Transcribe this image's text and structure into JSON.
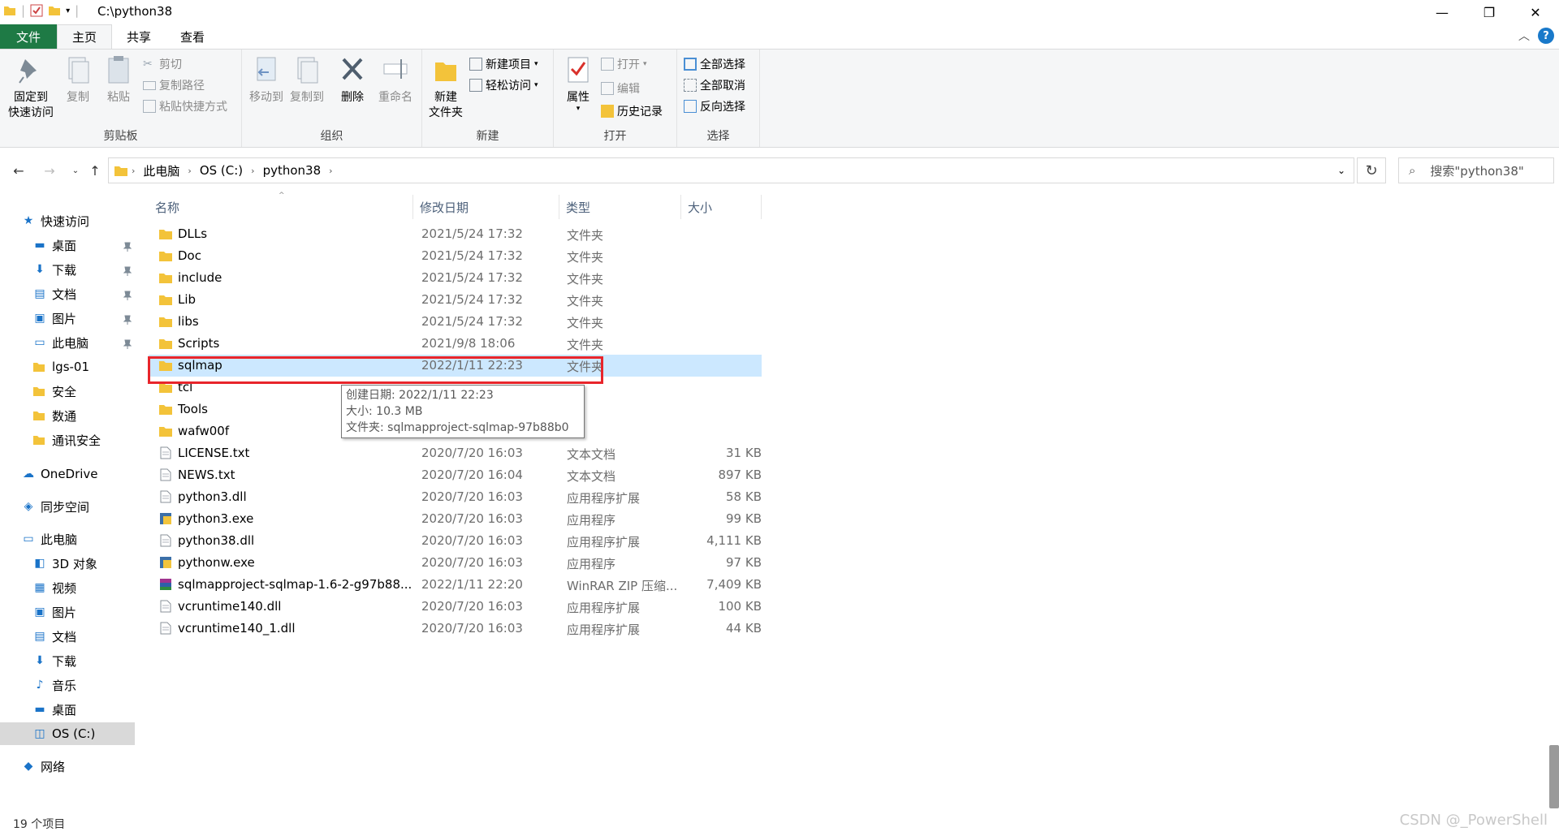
{
  "window": {
    "title": "C:\\python38",
    "minimize": "—",
    "maximize": "❐",
    "close": "✕"
  },
  "ribbon_tabs": [
    "文件",
    "主页",
    "共享",
    "查看"
  ],
  "ribbon": {
    "clipboard": {
      "label": "剪贴板",
      "pin_quick_access": "固定到\n快速访问",
      "copy": "复制",
      "paste": "粘贴",
      "cut": "剪切",
      "copy_path": "复制路径",
      "paste_shortcut": "粘贴快捷方式"
    },
    "organize": {
      "label": "组织",
      "move_to": "移动到",
      "copy_to": "复制到",
      "delete": "删除",
      "rename": "重命名"
    },
    "new": {
      "label": "新建",
      "new_folder": "新建\n文件夹",
      "new_item": "新建项目",
      "easy_access": "轻松访问"
    },
    "open": {
      "label": "打开",
      "properties": "属性",
      "open": "打开",
      "edit": "编辑",
      "history": "历史记录"
    },
    "select": {
      "label": "选择",
      "select_all": "全部选择",
      "select_none": "全部取消",
      "invert": "反向选择"
    }
  },
  "breadcrumb": [
    "此电脑",
    "OS (C:)",
    "python38"
  ],
  "search": {
    "placeholder": "搜索\"python38\""
  },
  "sidebar": {
    "items": [
      {
        "label": "快速访问",
        "icon": "star-icon",
        "pinned": false
      },
      {
        "label": "桌面",
        "icon": "desktop-icon",
        "pinned": true
      },
      {
        "label": "下载",
        "icon": "download-icon",
        "pinned": true
      },
      {
        "label": "文档",
        "icon": "document-icon",
        "pinned": true
      },
      {
        "label": "图片",
        "icon": "pictures-icon",
        "pinned": true
      },
      {
        "label": "此电脑",
        "icon": "computer-icon",
        "pinned": true
      },
      {
        "label": "lgs-01",
        "icon": "folder-icon",
        "pinned": false
      },
      {
        "label": "安全",
        "icon": "folder-icon",
        "pinned": false
      },
      {
        "label": "数通",
        "icon": "folder-icon",
        "pinned": false
      },
      {
        "label": "通讯安全",
        "icon": "folder-icon",
        "pinned": false
      },
      {
        "label": "OneDrive",
        "icon": "cloud-icon",
        "pinned": false
      },
      {
        "label": "同步空间",
        "icon": "sync-icon",
        "pinned": false
      },
      {
        "label": "此电脑",
        "icon": "computer-icon",
        "pinned": false
      },
      {
        "label": "3D 对象",
        "icon": "3d-icon",
        "pinned": false
      },
      {
        "label": "视频",
        "icon": "video-icon",
        "pinned": false
      },
      {
        "label": "图片",
        "icon": "pictures-icon",
        "pinned": false
      },
      {
        "label": "文档",
        "icon": "document-icon",
        "pinned": false
      },
      {
        "label": "下载",
        "icon": "download-icon",
        "pinned": false
      },
      {
        "label": "音乐",
        "icon": "music-icon",
        "pinned": false
      },
      {
        "label": "桌面",
        "icon": "desktop-icon",
        "pinned": false
      },
      {
        "label": "OS (C:)",
        "icon": "drive-icon",
        "pinned": false
      },
      {
        "label": "网络",
        "icon": "network-icon",
        "pinned": false
      }
    ]
  },
  "columns": [
    "名称",
    "修改日期",
    "类型",
    "大小"
  ],
  "files": [
    {
      "name": "DLLs",
      "date": "2021/5/24 17:32",
      "type": "文件夹",
      "size": "",
      "icon": "folder-icon"
    },
    {
      "name": "Doc",
      "date": "2021/5/24 17:32",
      "type": "文件夹",
      "size": "",
      "icon": "folder-icon"
    },
    {
      "name": "include",
      "date": "2021/5/24 17:32",
      "type": "文件夹",
      "size": "",
      "icon": "folder-icon"
    },
    {
      "name": "Lib",
      "date": "2021/5/24 17:32",
      "type": "文件夹",
      "size": "",
      "icon": "folder-icon"
    },
    {
      "name": "libs",
      "date": "2021/5/24 17:32",
      "type": "文件夹",
      "size": "",
      "icon": "folder-icon"
    },
    {
      "name": "Scripts",
      "date": "2021/9/8 18:06",
      "type": "文件夹",
      "size": "",
      "icon": "folder-icon"
    },
    {
      "name": "sqlmap",
      "date": "2022/1/11 22:23",
      "type": "文件夹",
      "size": "",
      "icon": "folder-icon",
      "selected": true
    },
    {
      "name": "tcl",
      "date": "",
      "type": "",
      "size": "",
      "icon": "folder-icon"
    },
    {
      "name": "Tools",
      "date": "",
      "type": "",
      "size": "",
      "icon": "folder-icon"
    },
    {
      "name": "wafw00f",
      "date": "",
      "type": "",
      "size": "",
      "icon": "folder-icon"
    },
    {
      "name": "LICENSE.txt",
      "date": "2020/7/20 16:03",
      "type": "文本文档",
      "size": "31 KB",
      "icon": "text-file-icon"
    },
    {
      "name": "NEWS.txt",
      "date": "2020/7/20 16:04",
      "type": "文本文档",
      "size": "897 KB",
      "icon": "text-file-icon"
    },
    {
      "name": "python3.dll",
      "date": "2020/7/20 16:03",
      "type": "应用程序扩展",
      "size": "58 KB",
      "icon": "dll-file-icon"
    },
    {
      "name": "python3.exe",
      "date": "2020/7/20 16:03",
      "type": "应用程序",
      "size": "99 KB",
      "icon": "python-exe-icon"
    },
    {
      "name": "python38.dll",
      "date": "2020/7/20 16:03",
      "type": "应用程序扩展",
      "size": "4,111 KB",
      "icon": "dll-file-icon"
    },
    {
      "name": "pythonw.exe",
      "date": "2020/7/20 16:03",
      "type": "应用程序",
      "size": "97 KB",
      "icon": "python-exe-icon"
    },
    {
      "name": "sqlmapproject-sqlmap-1.6-2-g97b88...",
      "date": "2022/1/11 22:20",
      "type": "WinRAR ZIP 压缩...",
      "size": "7,409 KB",
      "icon": "winrar-icon"
    },
    {
      "name": "vcruntime140.dll",
      "date": "2020/7/20 16:03",
      "type": "应用程序扩展",
      "size": "100 KB",
      "icon": "dll-file-icon"
    },
    {
      "name": "vcruntime140_1.dll",
      "date": "2020/7/20 16:03",
      "type": "应用程序扩展",
      "size": "44 KB",
      "icon": "dll-file-icon"
    }
  ],
  "tooltip": {
    "created": "创建日期: 2022/1/11 22:23",
    "size": "大小: 10.3 MB",
    "folder": "文件夹: sqlmapproject-sqlmap-97b88b0"
  },
  "status": {
    "count": "19 个项目"
  },
  "watermark": "CSDN @_PowerShell",
  "colors": {
    "accent": "#1e7a45",
    "selection": "#cce8ff",
    "highlight_box": "#e8252b",
    "folder": "#f3c33a"
  }
}
